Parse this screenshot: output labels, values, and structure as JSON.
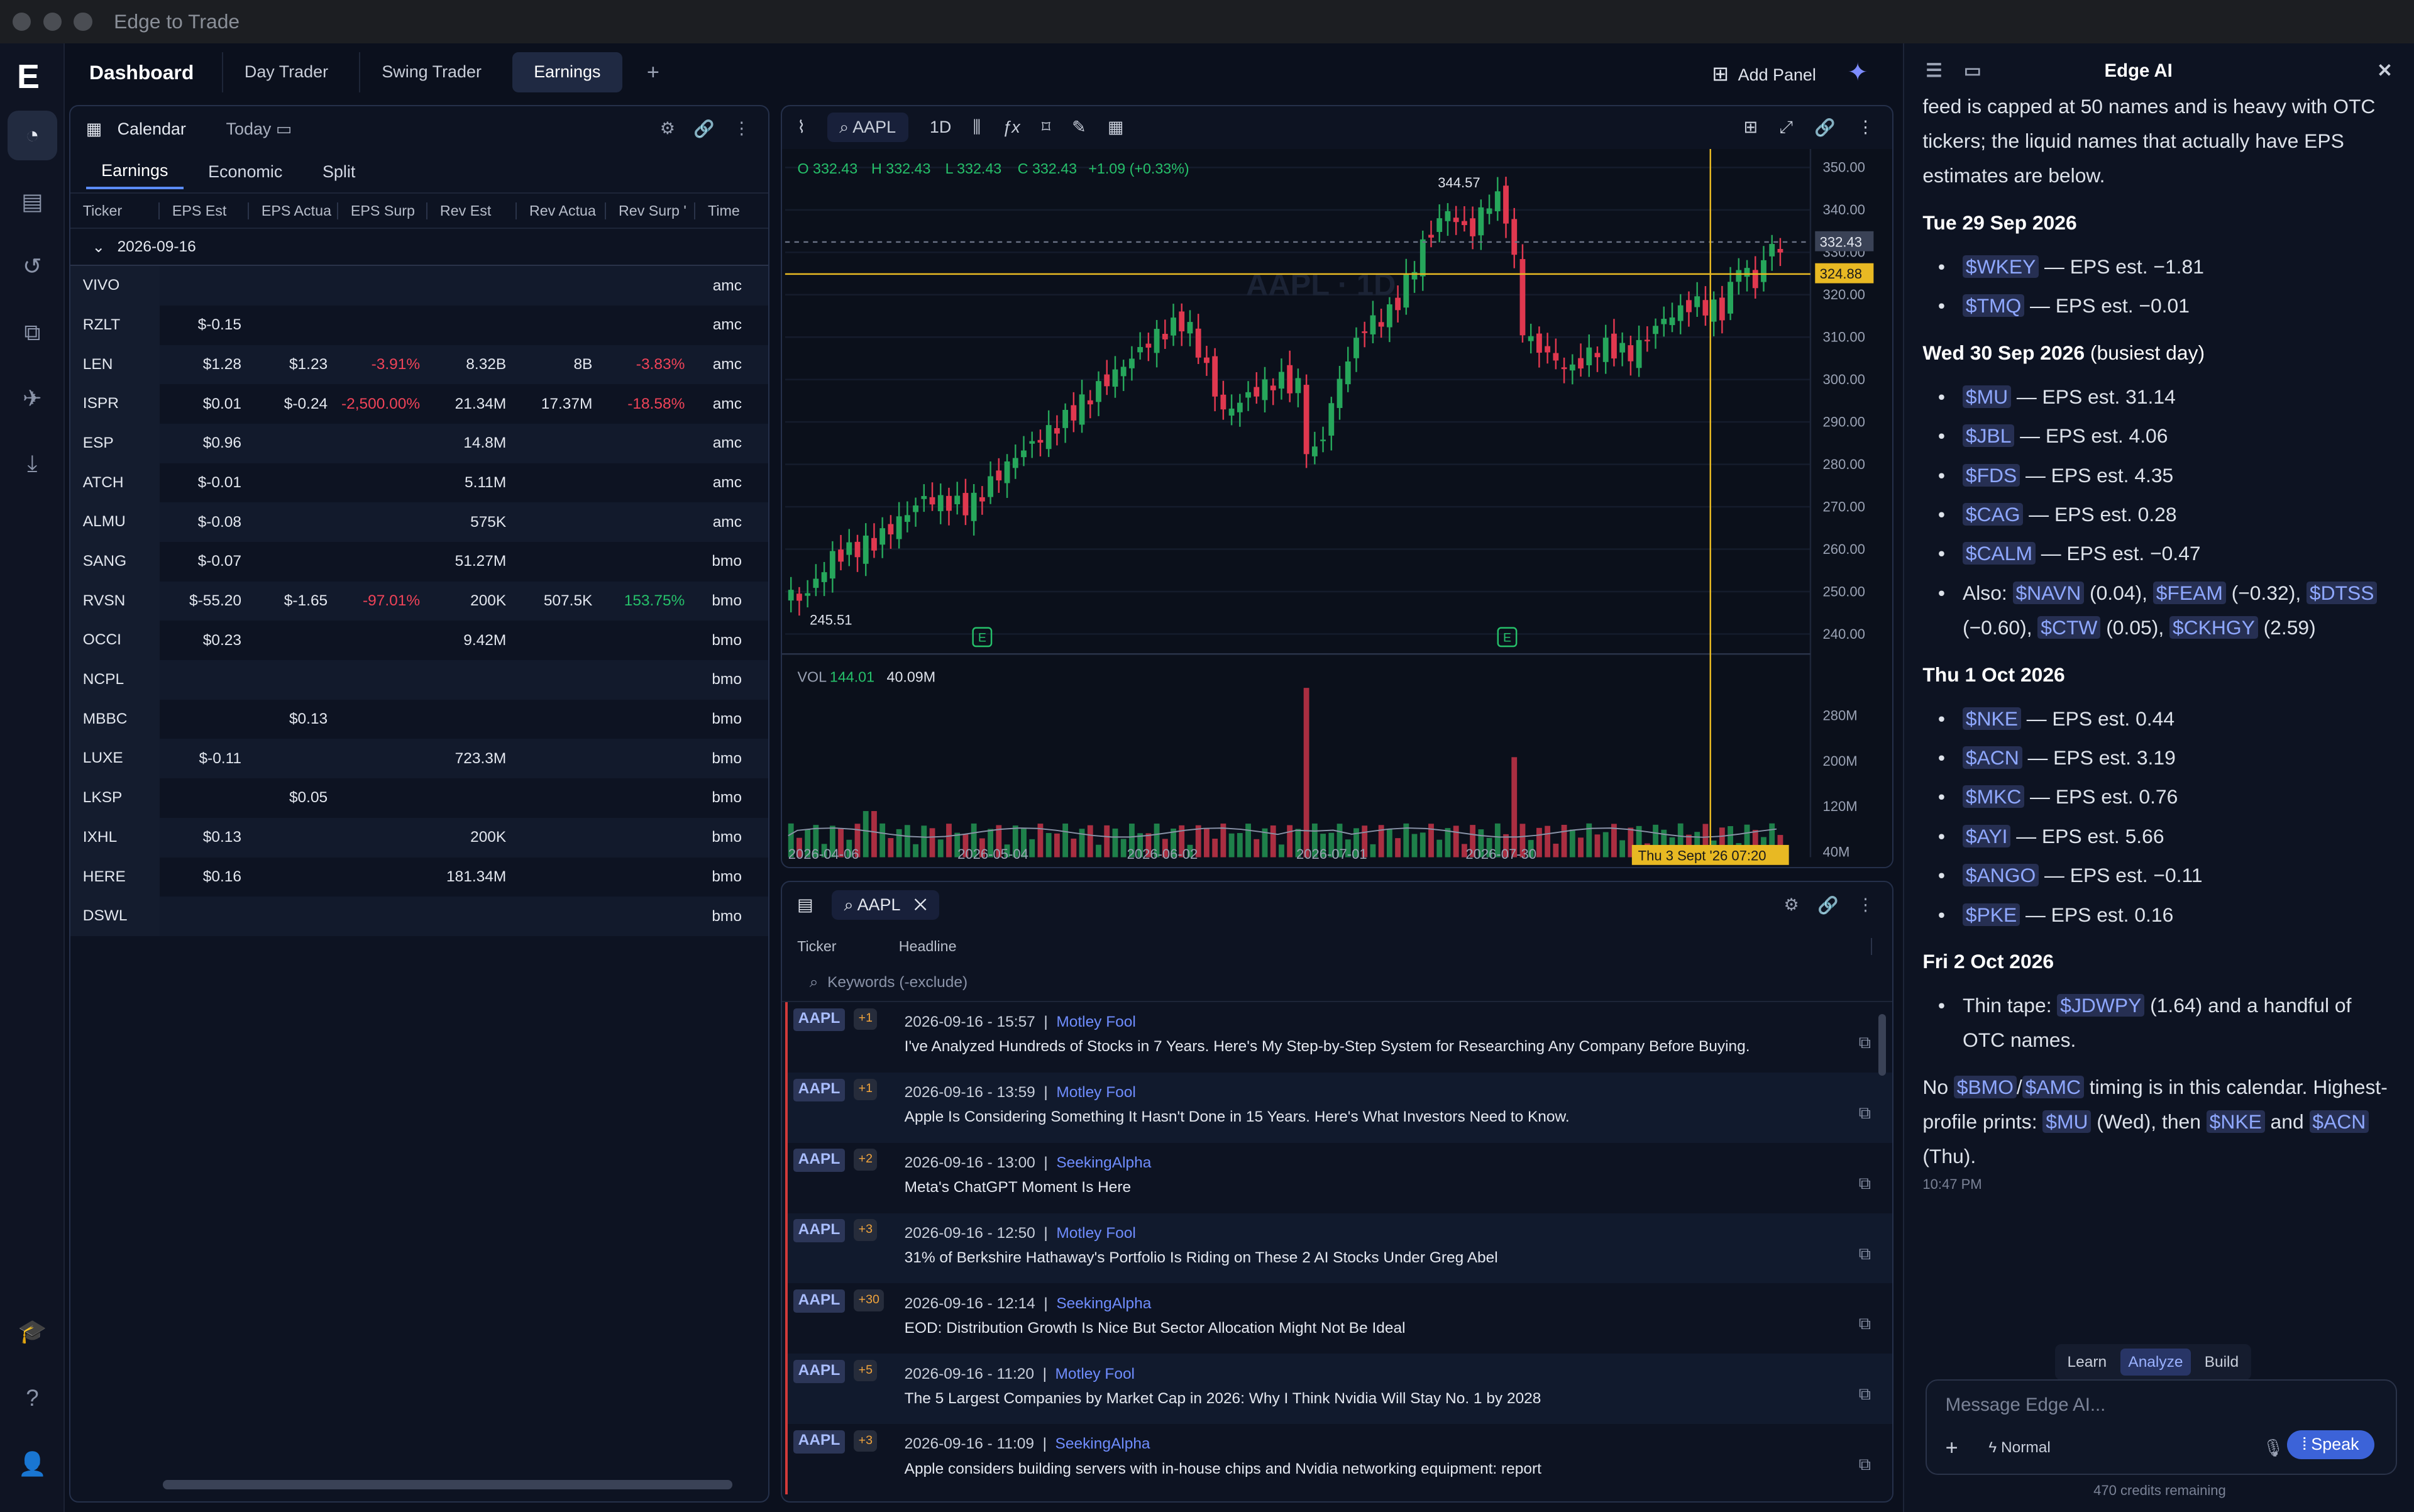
{
  "window": {
    "title": "Edge to Trade"
  },
  "topbar": {
    "dashboard": "Dashboard",
    "tabs": [
      "Day Trader",
      "Swing Trader",
      "Earnings"
    ],
    "add_tab": "+",
    "add_panel": "Add Panel"
  },
  "calendar": {
    "title": "Calendar",
    "today": "Today",
    "subtabs": [
      "Earnings",
      "Economic",
      "Split"
    ],
    "columns": [
      "Ticker",
      "EPS Est",
      "EPS Actua",
      "EPS Surp",
      "Rev Est",
      "Rev Actua",
      "Rev Surp '",
      "Time"
    ],
    "group": "2026-09-16",
    "rows": [
      [
        "VIVO",
        "",
        "",
        "",
        "",
        "",
        "",
        "amc"
      ],
      [
        "RZLT",
        "$-0.15",
        "",
        "",
        "",
        "",
        "",
        "amc"
      ],
      [
        "LEN",
        "$1.28",
        "$1.23",
        "-3.91%",
        "8.32B",
        "8B",
        "-3.83%",
        "amc"
      ],
      [
        "ISPR",
        "$0.01",
        "$-0.24",
        "-2,500.00%",
        "21.34M",
        "17.37M",
        "-18.58%",
        "amc"
      ],
      [
        "ESP",
        "$0.96",
        "",
        "",
        "14.8M",
        "",
        "",
        "amc"
      ],
      [
        "ATCH",
        "$-0.01",
        "",
        "",
        "5.11M",
        "",
        "",
        "amc"
      ],
      [
        "ALMU",
        "$-0.08",
        "",
        "",
        "575K",
        "",
        "",
        "amc"
      ],
      [
        "SANG",
        "$-0.07",
        "",
        "",
        "51.27M",
        "",
        "",
        "bmo"
      ],
      [
        "RVSN",
        "$-55.20",
        "$-1.65",
        "-97.01%",
        "200K",
        "507.5K",
        "153.75%",
        "bmo"
      ],
      [
        "OCCI",
        "$0.23",
        "",
        "",
        "9.42M",
        "",
        "",
        "bmo"
      ],
      [
        "NCPL",
        "",
        "",
        "",
        "",
        "",
        "",
        "bmo"
      ],
      [
        "MBBC",
        "",
        "$0.13",
        "",
        "",
        "",
        "",
        "bmo"
      ],
      [
        "LUXE",
        "$-0.11",
        "",
        "",
        "723.3M",
        "",
        "",
        "bmo"
      ],
      [
        "LKSP",
        "",
        "$0.05",
        "",
        "",
        "",
        "",
        "bmo"
      ],
      [
        "IXHL",
        "$0.13",
        "",
        "",
        "200K",
        "",
        "",
        "bmo"
      ],
      [
        "HERE",
        "$0.16",
        "",
        "",
        "181.34M",
        "",
        "",
        "bmo"
      ],
      [
        "DSWL",
        "",
        "",
        "",
        "",
        "",
        "",
        "bmo"
      ]
    ]
  },
  "chart": {
    "symbol": "AAPL",
    "interval": "1D",
    "ohlc": {
      "o": "O 332.43",
      "h": "H 332.43",
      "l": "L 332.43",
      "c": "C 332.43",
      "chg": "+1.09 (+0.33%)"
    },
    "watermark": "AAPL · 1D",
    "high_label": "344.57",
    "low_label": "245.51",
    "last_price": "332.43",
    "cross_price": "324.88",
    "price_ticks": [
      "350.00",
      "340.00",
      "330.00",
      "320.00",
      "310.00",
      "300.00",
      "290.00",
      "280.00",
      "270.00",
      "260.00",
      "250.00",
      "240.00"
    ],
    "vol_label": "VOL",
    "vol_a": "144.01",
    "vol_b": "40.09M",
    "vol_ticks": [
      "280M",
      "200M",
      "120M",
      "40M"
    ],
    "date_ticks": [
      "2026-04-06",
      "2026-05-04",
      "2026-06-02",
      "2026-07-01",
      "2026-07-30"
    ],
    "cross_date": "Thu 3 Sept '26 07:20",
    "earnings_marker": "E",
    "colors": {
      "up": "#26a65b",
      "down": "#e0384f",
      "cross": "#e8b923"
    }
  },
  "chart_data": {
    "type": "candlestick",
    "x_range": [
      "2026-04-06",
      "2026-09-16"
    ],
    "price_range": [
      240,
      350
    ],
    "high": 344.57,
    "low": 245.51,
    "last": 332.43,
    "crosshair_price": 324.88
  },
  "news": {
    "search": "AAPL",
    "columns": [
      "Ticker",
      "Headline"
    ],
    "placeholder": "Keywords (-exclude)",
    "items": [
      {
        "t": "AAPL",
        "n": "+1",
        "ts": "2026-09-16 - 15:57",
        "src": "Motley Fool",
        "h": "I've Analyzed Hundreds of Stocks in 7 Years. Here's My Step-by-Step System for Researching Any Company Before Buying."
      },
      {
        "t": "AAPL",
        "n": "+1",
        "ts": "2026-09-16 - 13:59",
        "src": "Motley Fool",
        "h": "Apple Is Considering Something It Hasn't Done in 15 Years. Here's What Investors Need to Know."
      },
      {
        "t": "AAPL",
        "n": "+2",
        "ts": "2026-09-16 - 13:00",
        "src": "SeekingAlpha",
        "h": "Meta's ChatGPT Moment Is Here"
      },
      {
        "t": "AAPL",
        "n": "+3",
        "ts": "2026-09-16 - 12:50",
        "src": "Motley Fool",
        "h": "31% of Berkshire Hathaway's Portfolio Is Riding on These 2 AI Stocks Under Greg Abel"
      },
      {
        "t": "AAPL",
        "n": "+30",
        "ts": "2026-09-16 - 12:14",
        "src": "SeekingAlpha",
        "h": "EOD: Distribution Growth Is Nice But Sector Allocation Might Not Be Ideal"
      },
      {
        "t": "AAPL",
        "n": "+5",
        "ts": "2026-09-16 - 11:20",
        "src": "Motley Fool",
        "h": "The 5 Largest Companies by Market Cap in 2026: Why I Think Nvidia Will Stay No. 1 by 2028"
      },
      {
        "t": "AAPL",
        "n": "+3",
        "ts": "2026-09-16 - 11:09",
        "src": "SeekingAlpha",
        "h": "Apple considers building servers with in-house chips and Nvidia networking equipment: report"
      }
    ]
  },
  "ai": {
    "title": "Edge AI",
    "intro": "feed is capped at 50 names and is heavy with OTC tickers; the liquid names that actually have EPS estimates are below.",
    "d1": "Tue 29 Sep 2026",
    "d1i": [
      [
        "$WKEY",
        "— EPS est. −1.81"
      ],
      [
        "$TMQ",
        "— EPS est. −0.01"
      ]
    ],
    "d2": "Wed 30 Sep 2026",
    "d2s": "(busiest day)",
    "d2i": [
      [
        "$MU",
        "— EPS est. 31.14"
      ],
      [
        "$JBL",
        "— EPS est. 4.06"
      ],
      [
        "$FDS",
        "— EPS est. 4.35"
      ],
      [
        "$CAG",
        "— EPS est. 0.28"
      ],
      [
        "$CALM",
        "— EPS est. −0.47"
      ]
    ],
    "also": {
      "l": "Also:",
      "a": "$NAVN",
      "av": "(0.04),",
      "b": "$FEAM",
      "bv": "(−0.32),",
      "c": "$DTSS",
      "cv": "(−0.60),",
      "d": "$CTW",
      "dv": "(0.05),",
      "e": "$CKHGY",
      "ev": "(2.59)"
    },
    "d3": "Thu 1 Oct 2026",
    "d3i": [
      [
        "$NKE",
        "— EPS est. 0.44"
      ],
      [
        "$ACN",
        "— EPS est. 3.19"
      ],
      [
        "$MKC",
        "— EPS est. 0.76"
      ],
      [
        "$AYI",
        "— EPS est. 5.66"
      ],
      [
        "$ANGO",
        "— EPS est. −0.11"
      ],
      [
        "$PKE",
        "— EPS est. 0.16"
      ]
    ],
    "d4": "Fri 2 Oct 2026",
    "d4a": "Thin tape:",
    "d4t": "$JDWPY",
    "d4b": "(1.64) and a handful of OTC names.",
    "f1": "No",
    "f2": "$BMO",
    "f3": "/",
    "f4": "$AMC",
    "f5": "timing is in this calendar. Highest-profile prints:",
    "f6": "$MU",
    "f7": "(Wed), then",
    "f8": "$NKE",
    "f9": "and",
    "f10": "$ACN",
    "f11": "(Thu).",
    "time": "10:47 PM",
    "modes": [
      "Learn",
      "Analyze",
      "Build"
    ],
    "placeholder": "Message Edge AI...",
    "mode": "Normal",
    "speak": "Speak",
    "credits": "470 credits remaining"
  }
}
